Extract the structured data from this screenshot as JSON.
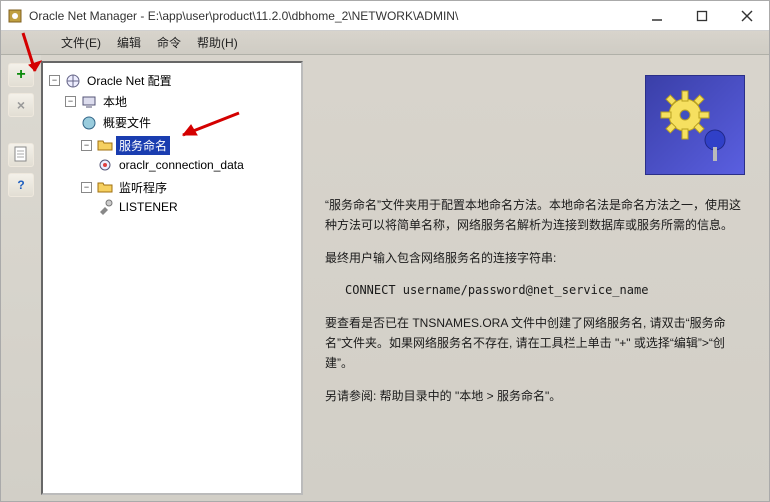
{
  "window": {
    "title": "Oracle Net Manager - E:\\app\\user\\product\\11.2.0\\dbhome_2\\NETWORK\\ADMIN\\"
  },
  "menu": {
    "file": "文件(E)",
    "edit": "编辑",
    "command": "命令",
    "help": "帮助(H)"
  },
  "toolbar": {
    "add": "+",
    "delete": "×",
    "doc": "doc",
    "help": "?"
  },
  "tree": {
    "root": "Oracle Net 配置",
    "local": "本地",
    "profile": "概要文件",
    "service_naming": "服务命名",
    "conn_data": "oraclr_connection_data",
    "listener_folder": "监听程序",
    "listener": "LISTENER"
  },
  "content": {
    "p1": "“服务命名”文件夹用于配置本地命名方法。本地命名法是命名方法之一，使用这种方法可以将简单名称，网络服务名解析为连接到数据库或服务所需的信息。",
    "p2": "最终用户输入包含网络服务名的连接字符串:",
    "connect": "CONNECT username/password@net_service_name",
    "p3": "要查看是否已在 TNSNAMES.ORA 文件中创建了网络服务名, 请双击“服务命名”文件夹。如果网络服务名不存在, 请在工具栏上单击 \"+\" 或选择“编辑”>“创建”。",
    "p4": "另请参阅: 帮助目录中的 \"本地 > 服务命名\"。"
  }
}
